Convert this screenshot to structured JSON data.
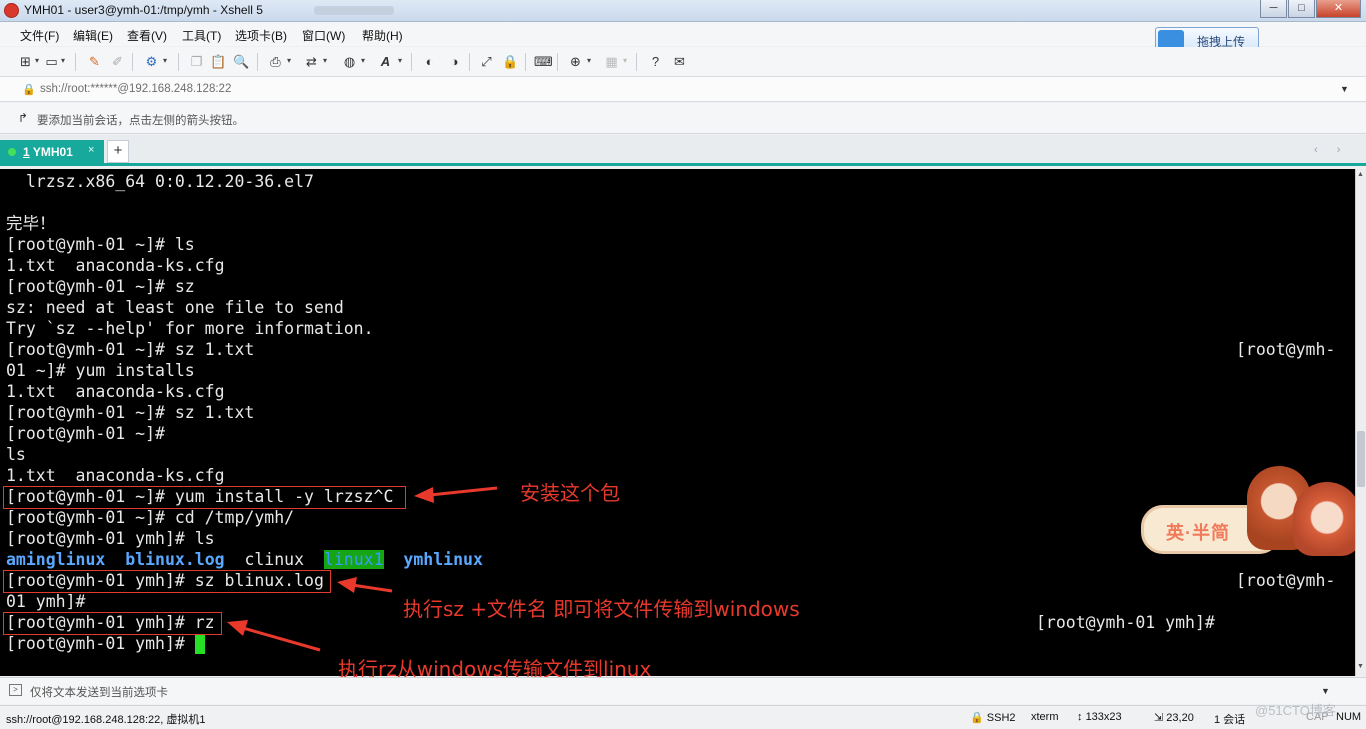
{
  "window": {
    "title": "YMH01 - user3@ymh-01:/tmp/ymh - Xshell 5",
    "minimize_glyph": "─",
    "maximize_glyph": "□",
    "close_glyph": "✕"
  },
  "menu": [
    "文件(F)",
    "编辑(E)",
    "查看(V)",
    "工具(T)",
    "选项卡(B)",
    "窗口(W)",
    "帮助(H)"
  ],
  "upload_button": {
    "label": "拖拽上传",
    "icon": "cloud-upload-icon"
  },
  "toolbar": {
    "icons": [
      "new-session-icon",
      "open-icon",
      "edit-icon",
      "disconnect-icon",
      "properties-icon",
      "copy-icon",
      "paste-icon",
      "find-icon",
      "print-icon",
      "transfer-icon",
      "globe-icon",
      "font-icon",
      "xftp-icon",
      "xmanager-icon",
      "fullscreen-icon",
      "lock-icon",
      "keyboard-icon",
      "compose-icon",
      "layout-icon",
      "help-icon",
      "chat-icon"
    ]
  },
  "address": {
    "value": "ssh://root:******@192.168.248.128:22"
  },
  "hint": {
    "text": "要添加当前会话，点击左侧的箭头按钮。"
  },
  "tabs": [
    {
      "number": "1",
      "label": "YMH01",
      "status": "connected",
      "close": "×"
    }
  ],
  "tab_add": "+",
  "tab_nav": "‹ ›",
  "terminal": {
    "lines": [
      "  lrzsz.x86_64 0:0.12.20-36.el7",
      "",
      "完毕！",
      "[root@ymh-01 ~]# ls",
      "1.txt  anaconda-ks.cfg",
      "[root@ymh-01 ~]# sz",
      "sz: need at least one file to send",
      "Try `sz --help' for more information.",
      "[root@ymh-01 ~]# sz 1.txt",
      "01 ~]# yum installs",
      "1.txt  anaconda-ks.cfg",
      "[root@ymh-01 ~]# sz 1.txt",
      "[root@ymh-01 ~]#",
      "ls",
      "1.txt  anaconda-ks.cfg",
      "[root@ymh-01 ~]# yum install -y lrzsz^C",
      "[root@ymh-01 ~]# cd /tmp/ymh/",
      "[root@ymh-01 ymh]# ls",
      "",
      "[root@ymh-01 ymh]# sz blinux.log",
      "01 ymh]#",
      "[root@ymh-01 ymh]# rz",
      "[root@ymh-01 ymh]# "
    ],
    "ls_output": {
      "aminglinux": "aminglinux",
      "blinux": "blinux.log",
      "clinux": "clinux",
      "linux1": "linux1",
      "ymhlinux": "ymhlinux"
    },
    "right_text": {
      "r1": "[root@ymh-",
      "r2": "[root@ymh-",
      "r3": "[root@ymh-01 ymh]#"
    }
  },
  "annotations": {
    "install": "安装这个包",
    "sz": "执行sz +文件名 即可将文件传输到windows",
    "rz": "执行rz从windows传输文件到linux"
  },
  "sticker": {
    "text": "英·半简"
  },
  "send_bar": {
    "text": "仅将文本发送到当前选项卡"
  },
  "status": {
    "connection": "ssh://root@192.168.248.128:22, 虚拟机1",
    "protocol": "SSH2",
    "term": "xterm",
    "size": "133x23",
    "position": "23,20",
    "sessions": "1 会话",
    "caps": "CAP",
    "num": "NUM"
  },
  "watermark": "@51CTO博客",
  "colors": {
    "tab_accent": "#17a99b",
    "annotation": "#e8392c",
    "terminal_bg": "#000000",
    "ls_blue": "#5aa8ff",
    "cursor": "#26e026"
  }
}
